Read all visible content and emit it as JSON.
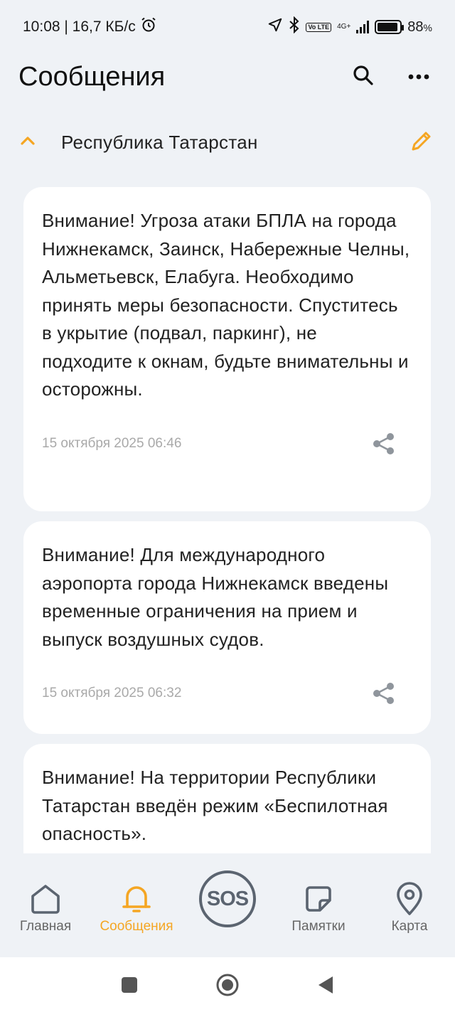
{
  "status_bar": {
    "time_speed": "10:08 | 16,7 КБ/с",
    "network_type": "4G+",
    "lte_badge": "Vo LTE",
    "battery": "88",
    "battery_unit": "%",
    "battery_level": 0.88
  },
  "header": {
    "title": "Сообщения",
    "search_icon": "search-icon",
    "more_icon": "more-horizontal-icon"
  },
  "region": {
    "name": "Республика Татарстан",
    "collapse_icon": "chevron-up-icon",
    "edit_icon": "pencil-icon",
    "accent_color": "#f5a623"
  },
  "messages": [
    {
      "text": "Внимание! Угроза атаки БПЛА на города Нижнекамск, Заинск, Набережные Челны, Альметьевск, Елабуга. Необходимо принять меры безопасности. Спуститесь в укрытие (подвал, паркинг), не подходите к окнам, будьте внимательны и осторожны.",
      "date": "15 октября 2025 06:46"
    },
    {
      "text": "Внимание! Для международного аэропорта города Нижнекамск введены временные ограничения на прием и выпуск воздушных судов.",
      "date": "15 октября 2025 06:32"
    },
    {
      "text": "Внимание! На территории Республики Татарстан введён режим «Беспилотная опасность».",
      "date": ""
    }
  ],
  "bottom_nav": {
    "home": "Главная",
    "messages": "Сообщения",
    "sos": "SOS",
    "tips": "Памятки",
    "map": "Карта",
    "active": "messages"
  },
  "system_nav": {
    "recent_icon": "square-icon",
    "home_icon": "circle-icon",
    "back_icon": "triangle-back-icon"
  }
}
